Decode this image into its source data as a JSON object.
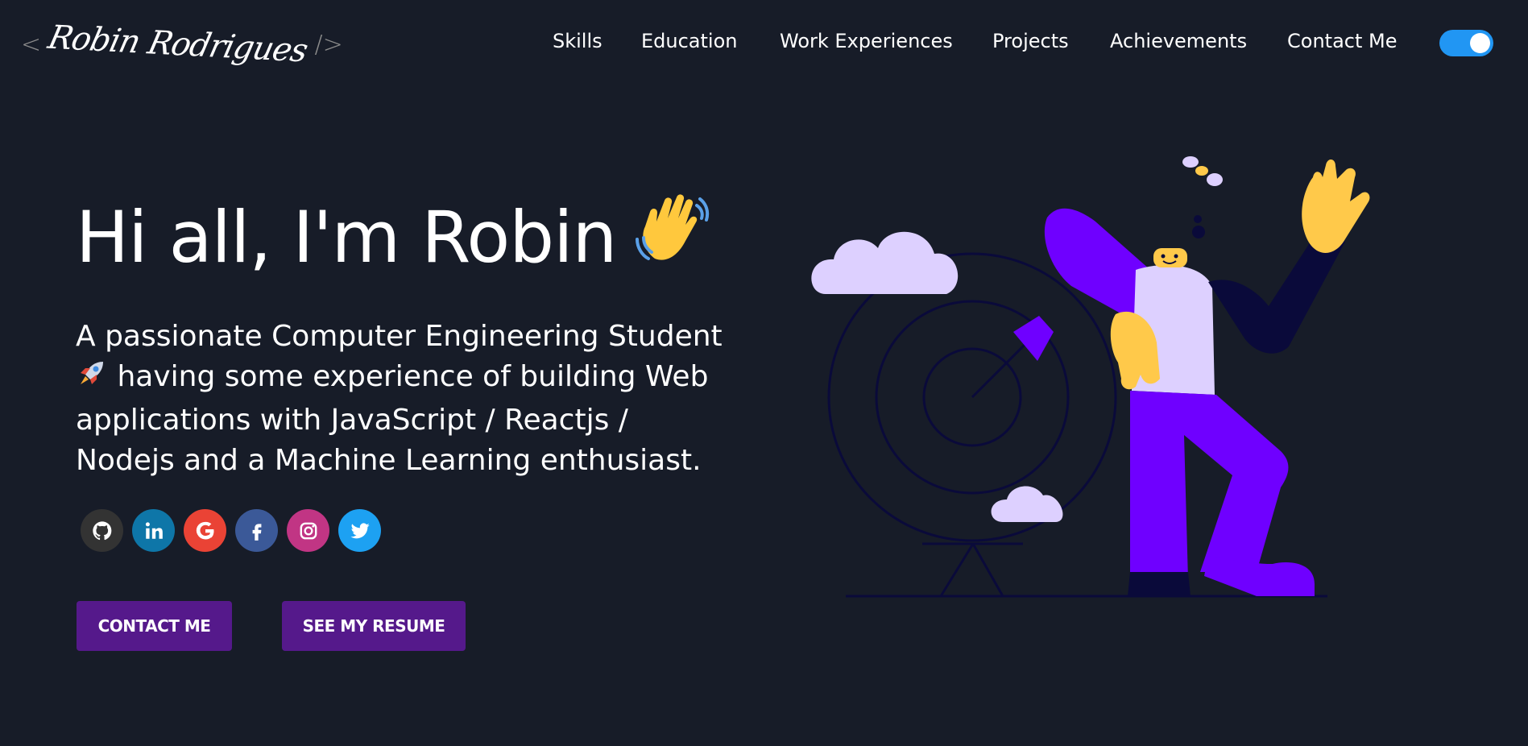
{
  "header": {
    "logo": {
      "open": "<",
      "name": "Robin Rodrigues",
      "close": "/>"
    },
    "nav": [
      {
        "label": "Skills"
      },
      {
        "label": "Education"
      },
      {
        "label": "Work Experiences"
      },
      {
        "label": "Projects"
      },
      {
        "label": "Achievements"
      },
      {
        "label": "Contact Me"
      }
    ],
    "theme_toggle": {
      "state": "on",
      "color": "#2196f3"
    }
  },
  "hero": {
    "greeting": "Hi all, I'm Robin",
    "wave_icon": "waving-hand-icon",
    "subtitle_lines": [
      "A passionate Computer Engineering Student",
      "having some experience of building Web",
      "applications with JavaScript / Reactjs /",
      "Nodejs and a Machine Learning enthusiast."
    ],
    "rocket_icon": "rocket-icon",
    "socials": [
      {
        "icon": "github-icon",
        "color": "#333333"
      },
      {
        "icon": "linkedin-icon",
        "color": "#0e76a8"
      },
      {
        "icon": "google-icon",
        "color": "#ea4335"
      },
      {
        "icon": "facebook-icon",
        "color": "#3b5998"
      },
      {
        "icon": "instagram-icon",
        "color": "#c13584"
      },
      {
        "icon": "twitter-icon",
        "color": "#1da1f2"
      }
    ],
    "buttons": {
      "contact": "CONTACT ME",
      "resume": "SEE MY RESUME"
    }
  },
  "colors": {
    "background": "#171c28",
    "button": "#55198b",
    "accent_purple": "#6f00ff",
    "skin": "#ffc94a",
    "cloud": "#ddd0ff"
  }
}
